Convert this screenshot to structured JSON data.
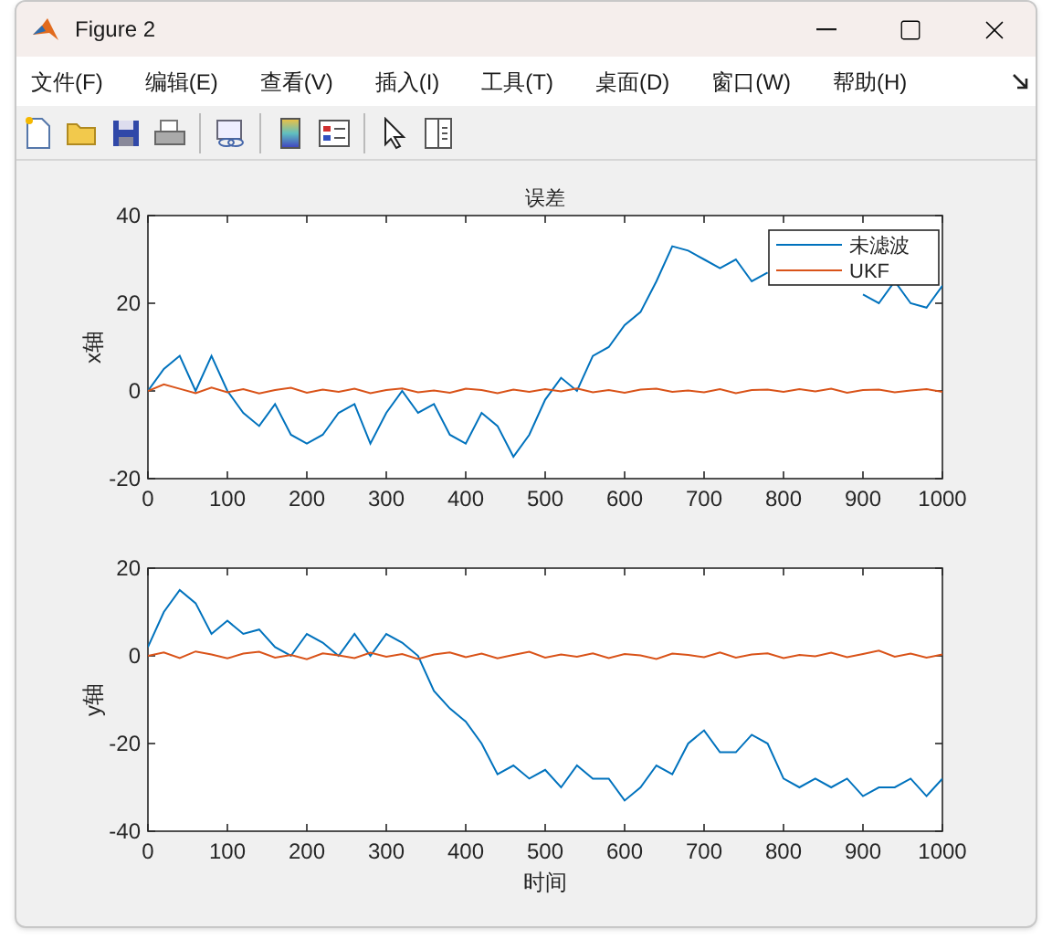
{
  "window": {
    "title": "Figure 2"
  },
  "menu": [
    "文件(F)",
    "编辑(E)",
    "查看(V)",
    "插入(I)",
    "工具(T)",
    "桌面(D)",
    "窗口(W)",
    "帮助(H)"
  ],
  "charts": [
    {
      "chart_data": {
        "type": "line",
        "title": "误差",
        "ylabel": "x轴",
        "x": [
          0,
          20,
          40,
          60,
          80,
          100,
          120,
          140,
          160,
          180,
          200,
          220,
          240,
          260,
          280,
          300,
          320,
          340,
          360,
          380,
          400,
          420,
          440,
          460,
          480,
          500,
          520,
          540,
          560,
          580,
          600,
          620,
          640,
          660,
          680,
          700,
          720,
          740,
          760,
          780,
          800,
          820,
          840,
          860,
          880,
          900,
          920,
          940,
          960,
          980,
          1000
        ],
        "series": [
          {
            "name": "未滤波",
            "color": "#0072bd",
            "values": [
              0,
              5,
              8,
              0,
              8,
              0,
              -5,
              -8,
              -3,
              -10,
              -12,
              -10,
              -5,
              -3,
              -12,
              -5,
              0,
              -5,
              -3,
              -10,
              -12,
              -5,
              -8,
              -15,
              -10,
              -2,
              3,
              0,
              8,
              10,
              15,
              18,
              25,
              33,
              32,
              30,
              28,
              30,
              25,
              27,
              null,
              null,
              null,
              null,
              null,
              22,
              20,
              25,
              20,
              19,
              24
            ]
          },
          {
            "name": "UKF",
            "color": "#d95319",
            "values": [
              0,
              1.5,
              0.5,
              -0.5,
              0.8,
              -0.3,
              0.4,
              -0.6,
              0.2,
              0.7,
              -0.4,
              0.3,
              -0.2,
              0.5,
              -0.5,
              0.2,
              0.6,
              -0.3,
              0.1,
              -0.4,
              0.5,
              0.2,
              -0.5,
              0.3,
              -0.2,
              0.4,
              -0.1,
              0.6,
              -0.3,
              0.2,
              -0.4,
              0.3,
              0.5,
              -0.2,
              0.1,
              -0.3,
              0.4,
              -0.5,
              0.2,
              0.3,
              -0.2,
              0.4,
              -0.1,
              0.5,
              -0.4,
              0.2,
              0.3,
              -0.3,
              0.1,
              0.4,
              -0.2
            ]
          }
        ],
        "legend": "top right",
        "xlim": [
          0,
          1000
        ],
        "ylim": [
          -20,
          40
        ],
        "xticks": [
          0,
          100,
          200,
          300,
          400,
          500,
          600,
          700,
          800,
          900,
          1000
        ],
        "yticks": [
          -20,
          0,
          20,
          40
        ]
      }
    },
    {
      "chart_data": {
        "type": "line",
        "xlabel": "时间",
        "ylabel": "y轴",
        "x": [
          0,
          20,
          40,
          60,
          80,
          100,
          120,
          140,
          160,
          180,
          200,
          220,
          240,
          260,
          280,
          300,
          320,
          340,
          360,
          380,
          400,
          420,
          440,
          460,
          480,
          500,
          520,
          540,
          560,
          580,
          600,
          620,
          640,
          660,
          680,
          700,
          720,
          740,
          760,
          780,
          800,
          820,
          840,
          860,
          880,
          900,
          920,
          940,
          960,
          980,
          1000
        ],
        "series": [
          {
            "color": "#0072bd",
            "values": [
              2,
              10,
              15,
              12,
              5,
              8,
              5,
              6,
              2,
              0,
              5,
              3,
              0,
              5,
              0,
              5,
              3,
              0,
              -8,
              -12,
              -15,
              -20,
              -27,
              -25,
              -28,
              -26,
              -30,
              -25,
              -28,
              -28,
              -33,
              -30,
              -25,
              -27,
              -20,
              -17,
              -22,
              -22,
              -18,
              -20,
              -28,
              -30,
              -28,
              -30,
              -28,
              -32,
              -30,
              -30,
              -28,
              -32,
              -28
            ]
          },
          {
            "color": "#d95319",
            "values": [
              0,
              0.8,
              -0.5,
              1,
              0.3,
              -0.6,
              0.5,
              0.9,
              -0.4,
              0.2,
              -0.8,
              0.6,
              0.1,
              -0.5,
              0.7,
              -0.2,
              0.4,
              -0.7,
              0.3,
              0.8,
              -0.3,
              0.5,
              -0.6,
              0.2,
              0.9,
              -0.4,
              0.3,
              -0.2,
              0.6,
              -0.5,
              0.4,
              0.1,
              -0.7,
              0.5,
              0.2,
              -0.3,
              0.8,
              -0.4,
              0.3,
              0.6,
              -0.5,
              0.2,
              -0.1,
              0.7,
              -0.3,
              0.4,
              1.2,
              -0.2,
              0.5,
              -0.4,
              0.3
            ]
          }
        ],
        "xlim": [
          0,
          1000
        ],
        "ylim": [
          -40,
          20
        ],
        "xticks": [
          0,
          100,
          200,
          300,
          400,
          500,
          600,
          700,
          800,
          900,
          1000
        ],
        "yticks": [
          -40,
          -20,
          0,
          20
        ]
      }
    }
  ]
}
